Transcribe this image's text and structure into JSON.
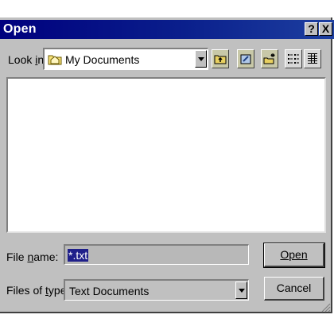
{
  "window": {
    "title": "Open"
  },
  "titlebar": {
    "help_symbol": "?",
    "close_symbol": "X"
  },
  "look_in": {
    "label": "Look in:",
    "value": "My Documents",
    "folder_icon": "folder-icon"
  },
  "toolbar": {
    "up_icon": "up-one-level-icon",
    "desktop_icon": "desktop-icon",
    "new_folder_icon": "new-folder-icon",
    "list_icon": "list-view-icon",
    "details_icon": "details-view-icon"
  },
  "file_name": {
    "label": "File name:",
    "value": "*.txt"
  },
  "file_type": {
    "label": "Files of type:",
    "value": "Text Documents"
  },
  "buttons": {
    "open": "Open",
    "cancel": "Cancel"
  },
  "colors": {
    "titlebar_start": "#00007e",
    "titlebar_end": "#1d3fa0",
    "face": "#c0c0c0",
    "selection": "#1f1f8a"
  }
}
